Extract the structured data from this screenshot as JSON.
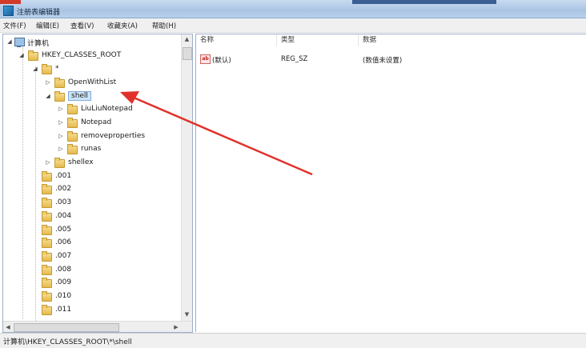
{
  "window": {
    "title": "注册表编辑器"
  },
  "menu": [
    "文件(F)",
    "编辑(E)",
    "查看(V)",
    "收藏夹(A)",
    "帮助(H)"
  ],
  "tree": {
    "root": "计算机",
    "hive": "HKEY_CLASSES_ROOT",
    "star": "*",
    "items": [
      {
        "label": "OpenWithList",
        "expander": "▷"
      },
      {
        "label": "shell",
        "expander": "◢",
        "selected": true
      },
      {
        "label": "LiuLiuNotepad",
        "expander": "▷"
      },
      {
        "label": "Notepad",
        "expander": "▷"
      },
      {
        "label": "removeproperties",
        "expander": "▷"
      },
      {
        "label": "runas",
        "expander": "▷"
      },
      {
        "label": "shellex",
        "expander": "▷"
      },
      {
        "label": ".001",
        "expander": ""
      },
      {
        "label": ".002",
        "expander": ""
      },
      {
        "label": ".003",
        "expander": ""
      },
      {
        "label": ".004",
        "expander": ""
      },
      {
        "label": ".005",
        "expander": ""
      },
      {
        "label": ".006",
        "expander": ""
      },
      {
        "label": ".007",
        "expander": ""
      },
      {
        "label": ".008",
        "expander": ""
      },
      {
        "label": ".009",
        "expander": ""
      },
      {
        "label": ".010",
        "expander": ""
      },
      {
        "label": ".011",
        "expander": ""
      }
    ]
  },
  "values": {
    "headers": {
      "name": "名称",
      "type": "类型",
      "data": "数据"
    },
    "rows": [
      {
        "name": "(默认)",
        "type": "REG_SZ",
        "data": "(数值未设置)"
      }
    ]
  },
  "status": {
    "path": "计算机\\HKEY_CLASSES_ROOT\\*\\shell"
  },
  "annotation": {
    "color": "#e0322b"
  }
}
